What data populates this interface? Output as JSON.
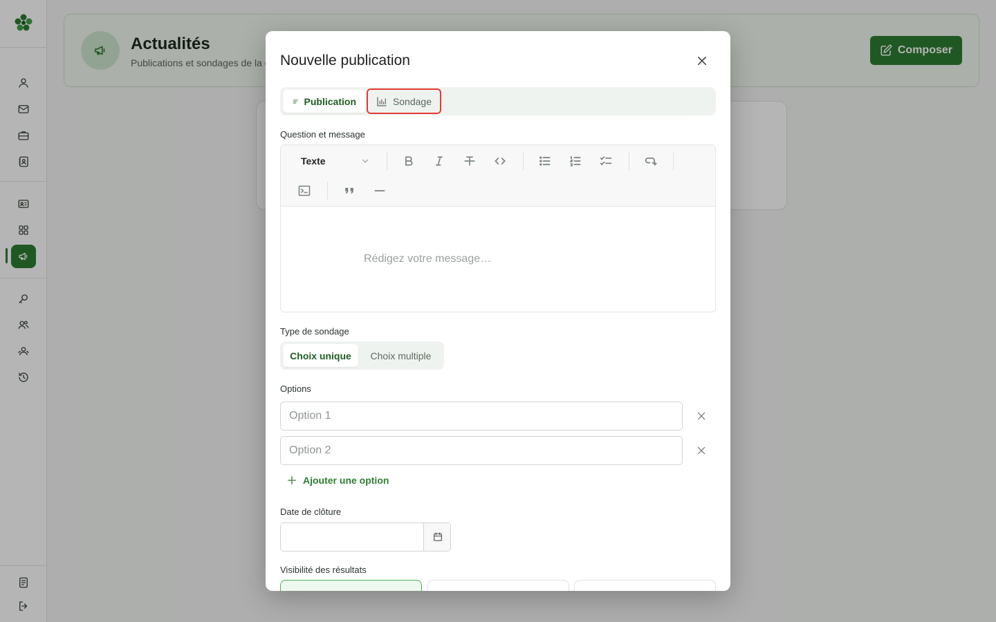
{
  "header": {
    "title": "Actualités",
    "subtitle": "Publications et sondages de la c",
    "compose_label": "Composer"
  },
  "modal": {
    "title": "Nouvelle publication",
    "tabs": [
      {
        "label": "Publication",
        "icon": "align-left-icon",
        "active": true
      },
      {
        "label": "Sondage",
        "icon": "bar-chart-icon",
        "active": false
      }
    ],
    "message_label": "Question et message",
    "editor": {
      "block_type": "Texte",
      "placeholder": "Rédigez votre message…"
    },
    "poll_type_label": "Type de sondage",
    "poll_types": [
      {
        "label": "Choix unique",
        "active": true
      },
      {
        "label": "Choix multiple",
        "active": false
      }
    ],
    "options_label": "Options",
    "options": [
      {
        "placeholder": "Option 1"
      },
      {
        "placeholder": "Option 2"
      }
    ],
    "add_option_label": "Ajouter une option",
    "close_date_label": "Date de clôture",
    "visibility_label": "Visibilité des résultats"
  },
  "colors": {
    "accent": "#2e7d32",
    "highlight": "#e53935"
  }
}
